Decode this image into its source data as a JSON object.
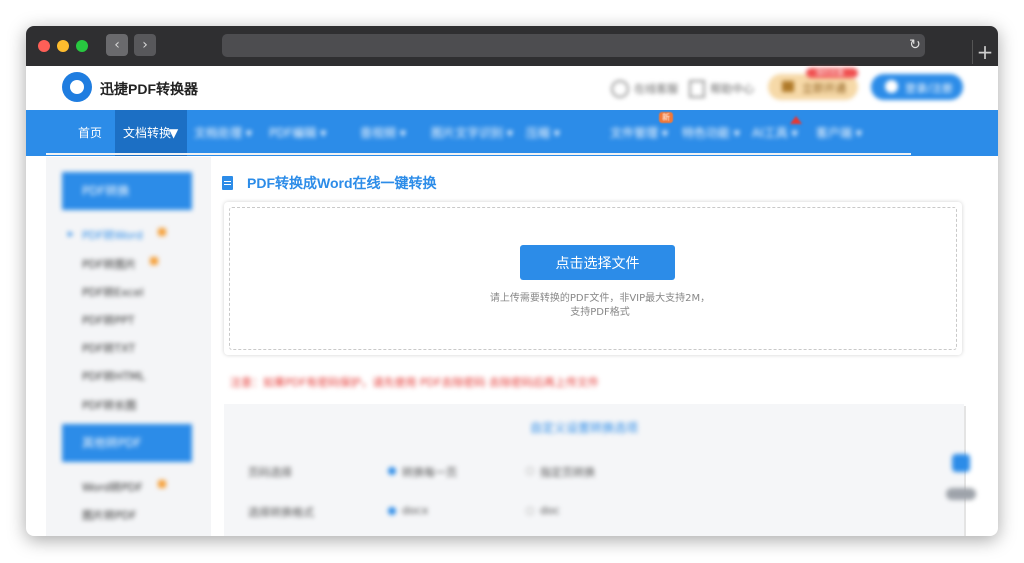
{
  "site": {
    "logo_text": "迅捷PDF转换器"
  },
  "header": {
    "link1": "在线客服",
    "link2": "帮助中心",
    "vip_label": "立即开通",
    "vip_badge": "限时优惠",
    "login_label": "登录/注册"
  },
  "nav": {
    "home": "首页",
    "active": "文档转换",
    "active_arrow": "▼",
    "blurred_items": [
      "文档处理 ▾",
      "PDF编辑 ▾",
      "音视频 ▾",
      "图片文字识别 ▾",
      "压缩 ▾",
      "文件管理 ▾",
      "特色功能 ▾",
      "AI工具 ▾",
      "客户端 ▾"
    ],
    "new_badge": "新"
  },
  "sidebar": {
    "group1_title": "PDF转换",
    "group1_items": [
      "PDF转Word",
      "PDF转图片",
      "PDF转Excel",
      "PDF转PPT",
      "PDF转TXT",
      "PDF转HTML",
      "PDF转长图"
    ],
    "group2_title": "其他转PDF",
    "group2_items": [
      "Word转PDF",
      "图片转PDF"
    ]
  },
  "main": {
    "title": "PDF转换成Word在线一键转换",
    "select_button": "点击选择文件",
    "hint_line1": "请上传需要转换的PDF文件，非VIP最大支持2M，",
    "hint_line2": "支持PDF格式",
    "notice": "注意：如果PDF有密码保护，请先使用 PDF去除密码 去除密码后再上传文件",
    "options_title": "自定义设置转换选项",
    "page_label": "页码选择",
    "page_opt1": "转换每一页",
    "page_opt2": "指定页转换",
    "format_label": "选择转换格式",
    "format_opt1": "docx",
    "format_opt2": "doc"
  },
  "colors": {
    "brand_blue": "#2c8ce8",
    "notice_red": "#e53935",
    "vip_gold": "#f6d9a8"
  }
}
